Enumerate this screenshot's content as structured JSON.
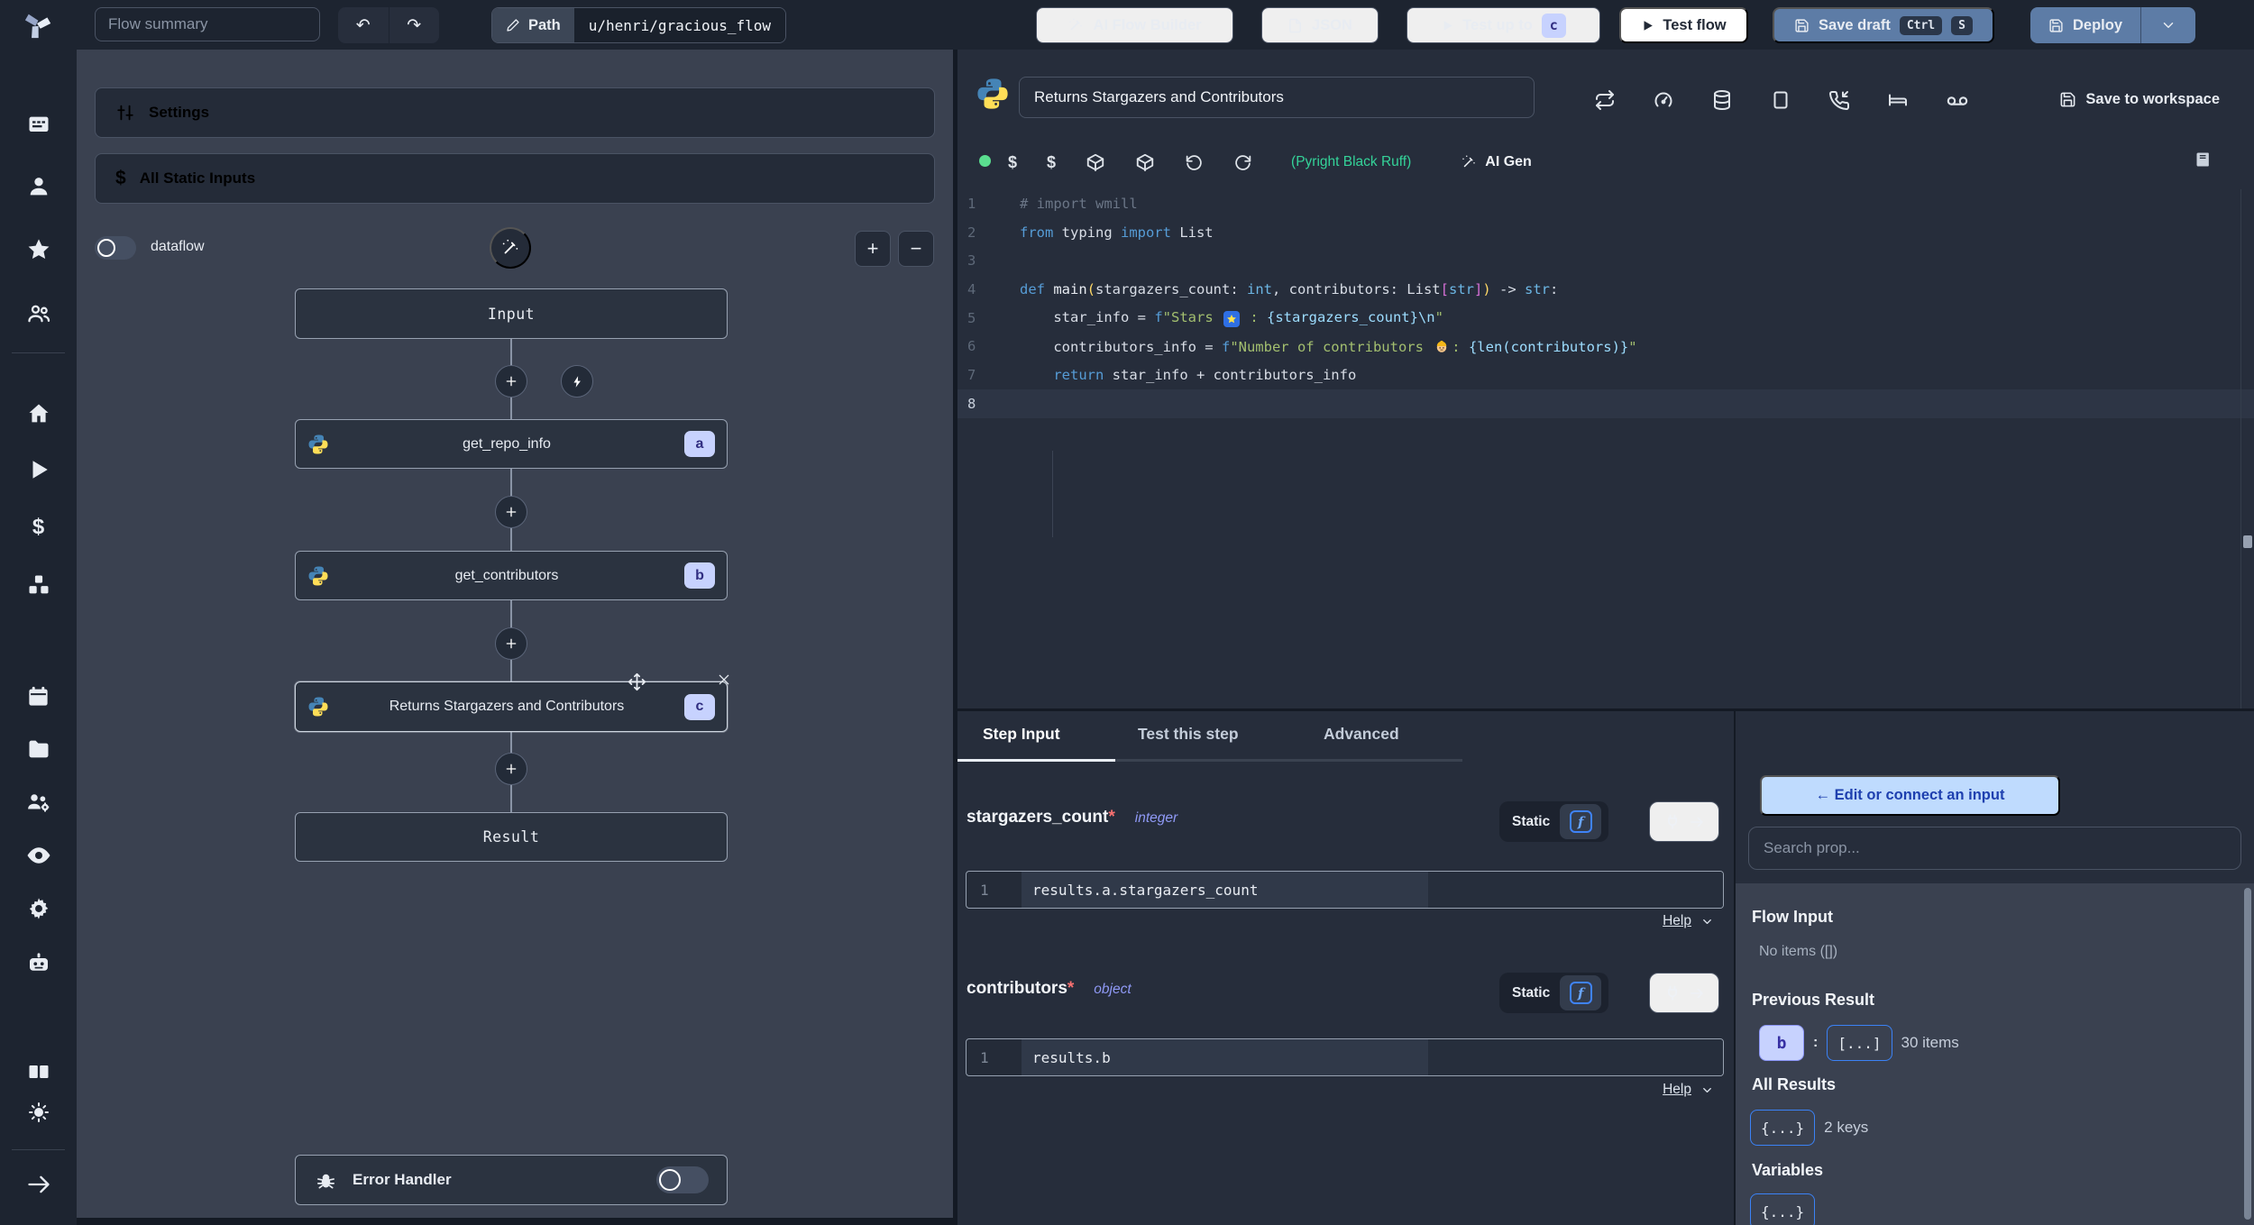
{
  "topbar": {
    "flow_summary_placeholder": "Flow summary",
    "path_label": "Path",
    "path_value": "u/henri/gracious_flow",
    "buttons": {
      "ai_flow_builder": "AI Flow Builder",
      "json": "JSON",
      "test_up_to": "Test up to",
      "test_up_to_badge": "c",
      "test_flow": "Test flow",
      "save_draft": "Save draft",
      "save_draft_keys": [
        "Ctrl",
        "S"
      ],
      "deploy": "Deploy"
    }
  },
  "glyphs": {
    "undo": "↶",
    "redo": "↷",
    "plus": "+",
    "minus": "−",
    "dollar": "$"
  },
  "sidebar": {
    "icons": [
      "workspace",
      "user",
      "star",
      "user-group",
      "home",
      "play",
      "dollar",
      "blocks",
      "calendar",
      "folder",
      "team-gear",
      "eye",
      "gear",
      "robot",
      "books",
      "sun",
      "arrow-right"
    ]
  },
  "flow": {
    "settings_label": "Settings",
    "static_inputs_label": "All Static Inputs",
    "dataflow_label": "dataflow",
    "nodes": {
      "input": "Input",
      "steps": [
        {
          "label": "get_repo_info",
          "badge": "a"
        },
        {
          "label": "get_contributors",
          "badge": "b"
        },
        {
          "label": "Returns Stargazers and Contributors",
          "badge": "c"
        }
      ],
      "result": "Result"
    },
    "error_handler_label": "Error Handler"
  },
  "editor": {
    "title": "Returns Stargazers and Contributors",
    "save_to_workspace": "Save to workspace",
    "header_icons": [
      "repeat",
      "gauge",
      "database",
      "square",
      "phone-incoming",
      "bed",
      "voicemail"
    ],
    "toolbar_icons": [
      "status-dot",
      "dollar",
      "dollar",
      "package",
      "package",
      "rotate-ccw",
      "refresh-cw"
    ],
    "lint_status": "(Pyright Black Ruff)",
    "ai_gen_label": "AI Gen",
    "code": {
      "language": "python",
      "active_line": 8,
      "lines": [
        [
          [
            "# import wmill",
            "comment"
          ]
        ],
        [
          [
            "from",
            "kw"
          ],
          [
            " typing ",
            "plain"
          ],
          [
            "import",
            "kw"
          ],
          [
            " List",
            "plain"
          ]
        ],
        [],
        [
          [
            "def",
            "kw"
          ],
          [
            " ",
            "plain"
          ],
          [
            "main",
            "fn"
          ],
          [
            "(",
            "paren"
          ],
          [
            "stargazers_count: ",
            "plain"
          ],
          [
            "int",
            "type"
          ],
          [
            ", contributors: List",
            "plain"
          ],
          [
            "[",
            "bracket"
          ],
          [
            "str",
            "type"
          ],
          [
            "]",
            "bracket"
          ],
          [
            ")",
            "paren"
          ],
          [
            " -> ",
            "plain"
          ],
          [
            "str",
            "type"
          ],
          [
            ":",
            "plain"
          ]
        ],
        [
          [
            "    star_info = ",
            "plain"
          ],
          [
            "f",
            "kw"
          ],
          [
            "\"Stars ",
            "str"
          ],
          [
            "🌟",
            "emoji-star"
          ],
          [
            " : ",
            "str"
          ],
          [
            "{stargazers_count}",
            "interp"
          ],
          [
            "\\n",
            "esc"
          ],
          [
            "\"",
            "str"
          ]
        ],
        [
          [
            "    contributors_info = ",
            "plain"
          ],
          [
            "f",
            "kw"
          ],
          [
            "\"Number of contributors ",
            "str"
          ],
          [
            "👷",
            "emoji-worker"
          ],
          [
            ": ",
            "str"
          ],
          [
            "{len(contributors)}",
            "interp"
          ],
          [
            "\"",
            "str"
          ]
        ],
        [
          [
            "    ",
            "plain"
          ],
          [
            "return",
            "kw"
          ],
          [
            " star_info + contributors_info",
            "plain"
          ]
        ],
        []
      ]
    }
  },
  "step_panel": {
    "tabs": [
      "Step Input",
      "Test this step",
      "Advanced"
    ],
    "active_tab": "Step Input",
    "static_label": "Static",
    "fexpr_label": "f",
    "help_label": "Help",
    "fields": [
      {
        "name": "stargazers_count",
        "required": "*",
        "type": "integer",
        "line_number": "1",
        "expr": "results.a.stargazers_count"
      },
      {
        "name": "contributors",
        "required": "*",
        "type": "object",
        "line_number": "1",
        "expr": "results.b"
      }
    ]
  },
  "connect_panel": {
    "edit_button": "← Edit or connect an input",
    "search_placeholder": "Search prop...",
    "sections": {
      "flow_input": {
        "title": "Flow Input",
        "empty": "No items ([])"
      },
      "previous_result": {
        "title": "Previous Result",
        "key_badge": "b",
        "colon": ":",
        "value_badge": "[...]",
        "meta": "30 items"
      },
      "all_results": {
        "title": "All Results",
        "value_badge": "{...}",
        "meta": "2 keys"
      },
      "variables": {
        "title": "Variables",
        "value_badge": "{...}"
      }
    }
  },
  "colors": {
    "accent_steel": "#5d7ca6",
    "badge_lavender": "#c7d2fe",
    "badge_text": "#3730a3",
    "connect_button_bg": "#bfdbfe",
    "connect_button_text": "#1e40af",
    "lint_green": "#34d399",
    "status_green": "#5ade8f",
    "outline_blue": "#3b82f6"
  }
}
